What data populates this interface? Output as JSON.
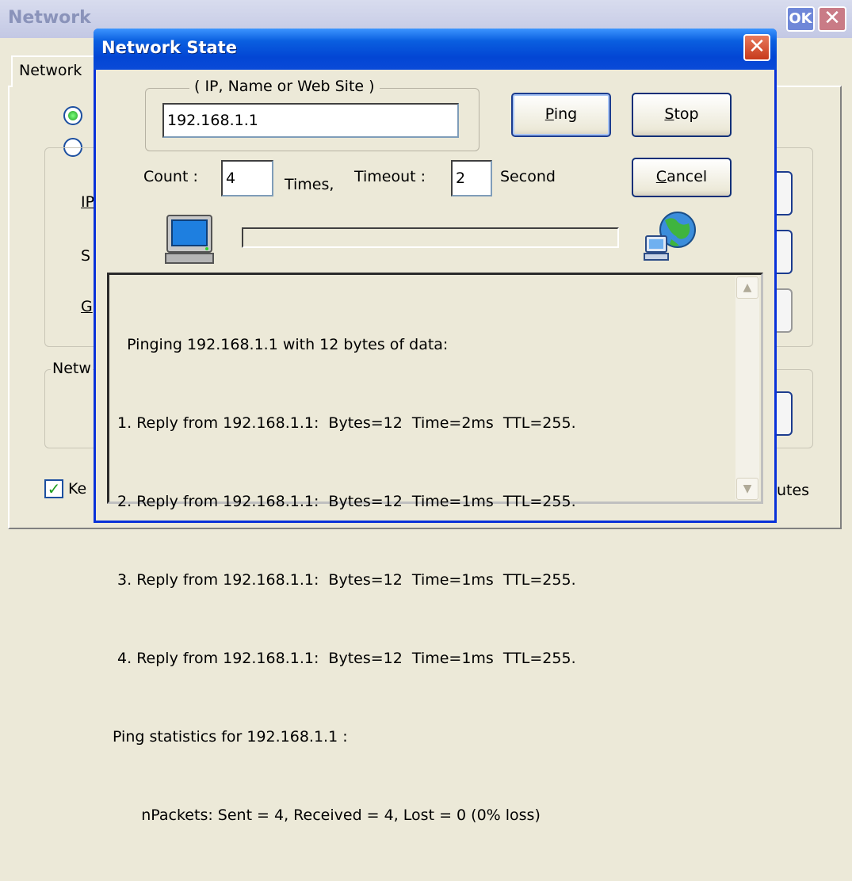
{
  "background_window": {
    "title": "Network",
    "ok_label": "OK",
    "close_label": "✕",
    "tab_label": "Network",
    "fragment_ip": "IP",
    "fragment_s": "S",
    "fragment_g": "G",
    "fragment_netw": "Netw",
    "fragment_ke": "Ke",
    "fragment_utes": "utes"
  },
  "dialog": {
    "title": "Network State",
    "close_label": "✕",
    "group_label": "( IP,  Name or Web Site )",
    "target_value": "192.168.1.1",
    "buttons": {
      "ping_mnemonic": "P",
      "ping_rest": "ing",
      "stop_mnemonic": "S",
      "stop_rest": "top",
      "cancel_mnemonic": "C",
      "cancel_rest": "ancel"
    },
    "count_label": "Count :",
    "count_value": "4",
    "times_label": "Times,",
    "timeout_label": "Timeout :",
    "timeout_value": "2",
    "second_label": "Second",
    "progress_fraction": 0,
    "log_lines": [
      "   Pinging 192.168.1.1 with 12 bytes of data:",
      " 1. Reply from 192.168.1.1:  Bytes=12  Time=2ms  TTL=255.",
      " 2. Reply from 192.168.1.1:  Bytes=12  Time=1ms  TTL=255.",
      " 3. Reply from 192.168.1.1:  Bytes=12  Time=1ms  TTL=255.",
      " 4. Reply from 192.168.1.1:  Bytes=12  Time=1ms  TTL=255.",
      "Ping statistics for 192.168.1.1 :",
      "      nPackets: Sent = 4, Received = 4, Lost = 0 (0% loss)"
    ]
  },
  "icons": {
    "computer": "computer-icon",
    "network": "network-globe-icon",
    "scroll_up": "scroll-up-icon",
    "scroll_down": "scroll-down-icon"
  }
}
